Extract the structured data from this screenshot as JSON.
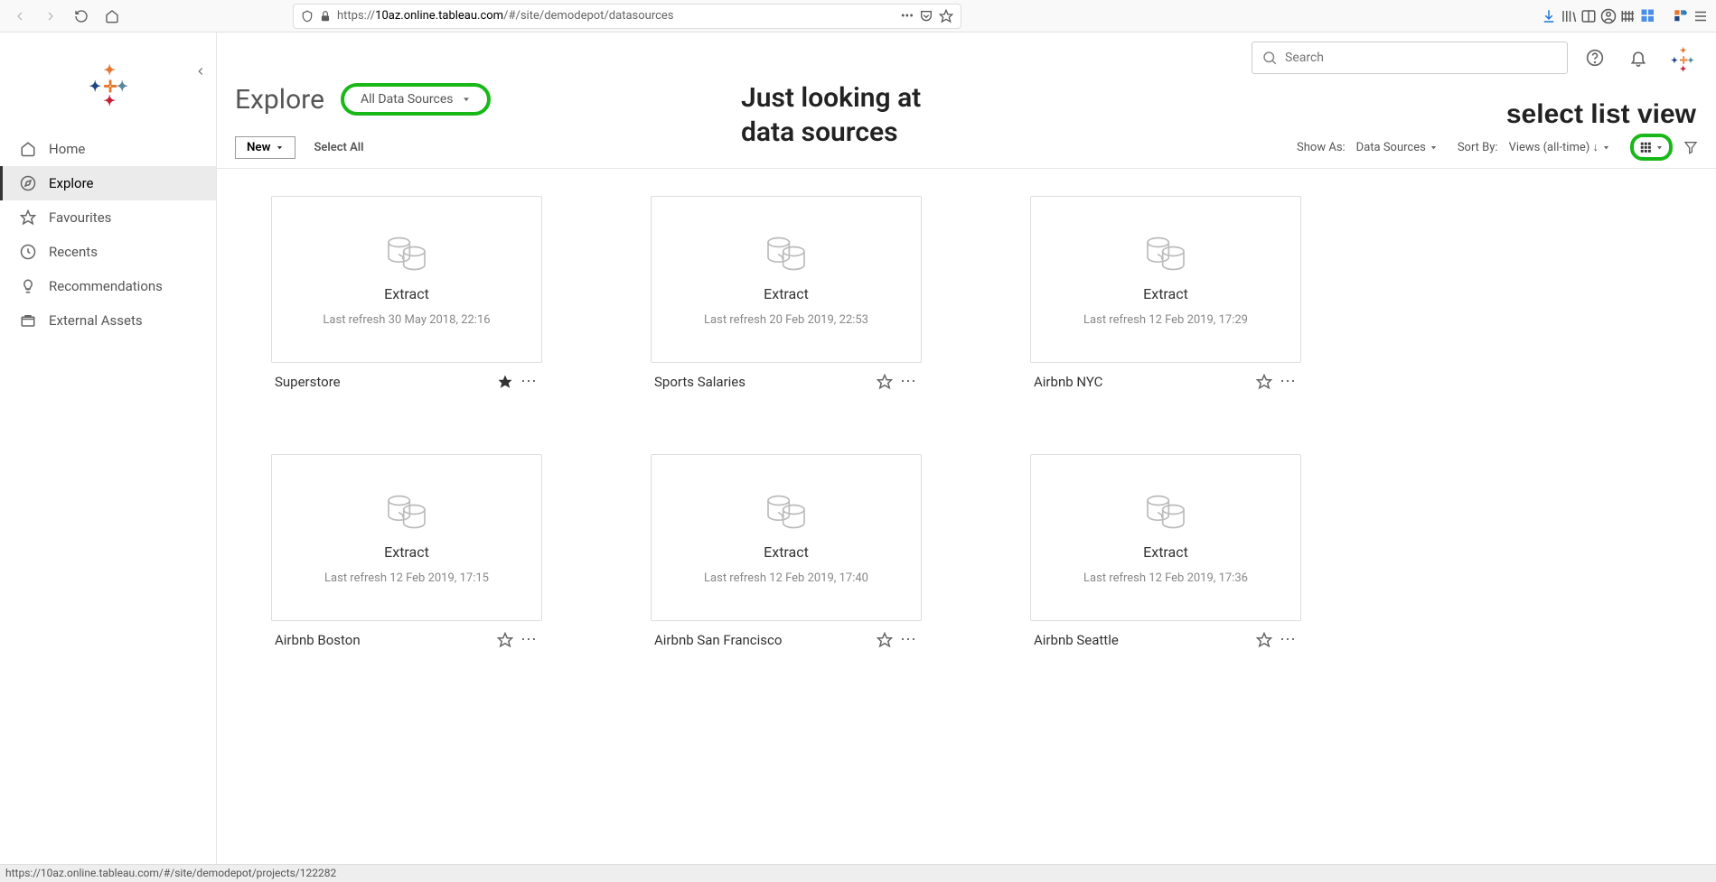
{
  "browser": {
    "url_prefix": "https://",
    "url_domain": "10az.online.tableau.com",
    "url_path": "/#/site/demodepot/datasources"
  },
  "sidebar": {
    "items": [
      {
        "label": "Home",
        "icon": "home"
      },
      {
        "label": "Explore",
        "icon": "explore"
      },
      {
        "label": "Favourites",
        "icon": "star"
      },
      {
        "label": "Recents",
        "icon": "clock"
      },
      {
        "label": "Recommendations",
        "icon": "bulb"
      },
      {
        "label": "External Assets",
        "icon": "box"
      }
    ],
    "active_index": 1
  },
  "header": {
    "title": "Explore",
    "filter_label": "All Data Sources"
  },
  "annotations": {
    "line1a": "Just looking at",
    "line1b": "data sources",
    "line2": "select list view"
  },
  "toolbar": {
    "new_label": "New",
    "select_all_label": "Select All",
    "show_as_label": "Show As:",
    "show_as_value": "Data Sources",
    "sort_by_label": "Sort By:",
    "sort_by_value": "Views (all-time) ↓"
  },
  "search": {
    "placeholder": "Search"
  },
  "datasources": [
    {
      "name": "Superstore",
      "kind": "Extract",
      "meta": "Last refresh 30 May 2018, 22:16",
      "starred": true
    },
    {
      "name": "Sports Salaries",
      "kind": "Extract",
      "meta": "Last refresh 20 Feb 2019, 22:53",
      "starred": false
    },
    {
      "name": "Airbnb NYC",
      "kind": "Extract",
      "meta": "Last refresh 12 Feb 2019, 17:29",
      "starred": false
    },
    {
      "name": "Airbnb Boston",
      "kind": "Extract",
      "meta": "Last refresh 12 Feb 2019, 17:15",
      "starred": false
    },
    {
      "name": "Airbnb San Francisco",
      "kind": "Extract",
      "meta": "Last refresh 12 Feb 2019, 17:40",
      "starred": false
    },
    {
      "name": "Airbnb Seattle",
      "kind": "Extract",
      "meta": "Last refresh 12 Feb 2019, 17:36",
      "starred": false
    }
  ],
  "status_bar": "https://10az.online.tableau.com/#/site/demodepot/projects/122282"
}
